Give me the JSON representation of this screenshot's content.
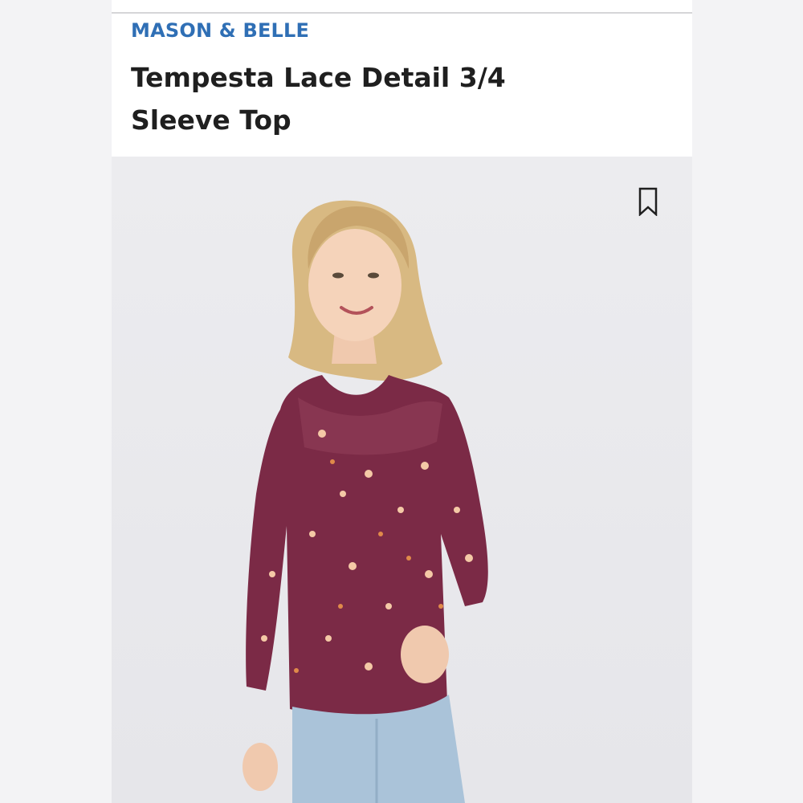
{
  "product": {
    "brand": "MASON & BELLE",
    "title": "Tempesta Lace Detail 3/4 Sleeve Top"
  },
  "icons": {
    "bookmark": "bookmark-icon"
  },
  "colors": {
    "brand": "#2f6fb5",
    "title": "#1f1f1f",
    "top_color": "#7b2a46",
    "jeans_color": "#aac3d9"
  }
}
